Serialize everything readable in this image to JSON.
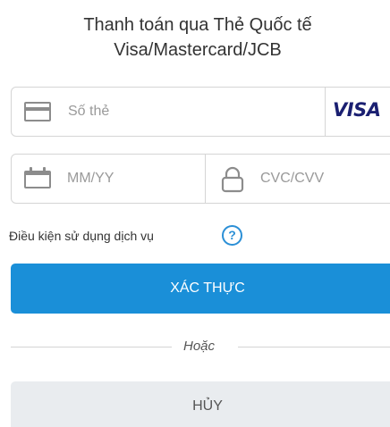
{
  "header": {
    "title_line1": "Thanh toán qua Thẻ Quốc tế",
    "title_line2": "Visa/Mastercard/JCB"
  },
  "card_number": {
    "placeholder": "Số thẻ",
    "value": "",
    "icon": "credit-card-icon",
    "brand": "VISA",
    "brand_color": "#1a1f71"
  },
  "expiry": {
    "placeholder": "MM/YY",
    "value": "",
    "icon": "calendar-icon"
  },
  "cvc": {
    "placeholder": "CVC/CVV",
    "value": "",
    "icon": "lock-icon"
  },
  "terms": {
    "label": "Điều kiện sử dụng dịch vụ",
    "help_symbol": "?",
    "help_icon": "question-circle-icon",
    "accent_color": "#2b8fd6"
  },
  "actions": {
    "verify_label": "XÁC THỰC",
    "verify_color": "#1a8fd8",
    "divider_text": "Hoặc",
    "cancel_label": "HỦY",
    "cancel_color": "#e9ecef"
  }
}
